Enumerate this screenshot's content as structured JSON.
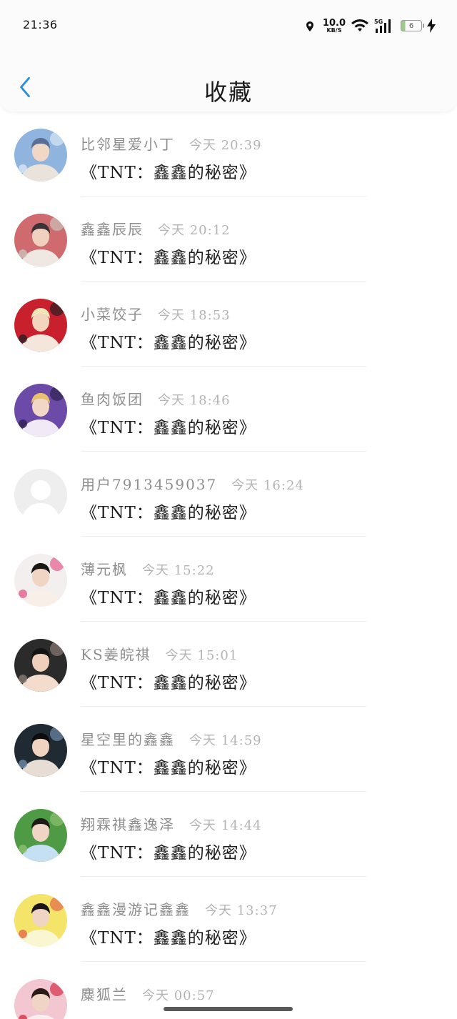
{
  "status_bar": {
    "time": "21:36",
    "net_speed_value": "10.0",
    "net_speed_unit": "KB/S",
    "signal_label": "5G",
    "battery_level": "6"
  },
  "nav": {
    "title": "收藏",
    "back_icon": "chevron-left-icon",
    "accent_color": "#2a8fd8"
  },
  "favorites": [
    {
      "user": "比邻星爱小丁",
      "time": "今天 20:39",
      "title": "《TNT：鑫鑫的秘密》",
      "avatar": "photo-plaid"
    },
    {
      "user": "鑫鑫辰辰",
      "time": "今天 20:12",
      "title": "《TNT：鑫鑫的秘密》",
      "avatar": "photo-duo"
    },
    {
      "user": "小菜饺子",
      "time": "今天 18:53",
      "title": "《TNT：鑫鑫的秘密》",
      "avatar": "photo-stage-red"
    },
    {
      "user": "鱼肉饭团",
      "time": "今天 18:46",
      "title": "《TNT：鑫鑫的秘密》",
      "avatar": "photo-stage-purple"
    },
    {
      "user": "用户7913459037",
      "time": "今天 16:24",
      "title": "《TNT：鑫鑫的秘密》",
      "avatar": "default-user"
    },
    {
      "user": "薄元枫",
      "time": "今天 15:22",
      "title": "《TNT：鑫鑫的秘密》",
      "avatar": "photo-flower"
    },
    {
      "user": "KS姜皖祺",
      "time": "今天 15:01",
      "title": "《TNT：鑫鑫的秘密》",
      "avatar": "photo-closeup"
    },
    {
      "user": "星空里的鑫鑫",
      "time": "今天 14:59",
      "title": "《TNT：鑫鑫的秘密》",
      "avatar": "photo-dark"
    },
    {
      "user": "翔霖祺鑫逸泽",
      "time": "今天 14:44",
      "title": "《TNT：鑫鑫的秘密》",
      "avatar": "photo-garden"
    },
    {
      "user": "鑫鑫漫游记鑫鑫",
      "time": "今天 13:37",
      "title": "《TNT：鑫鑫的秘密》",
      "avatar": "photo-yellow"
    },
    {
      "user": "麋狐兰",
      "time": "今天 00:57",
      "title": "",
      "avatar": "photo-pink"
    }
  ]
}
